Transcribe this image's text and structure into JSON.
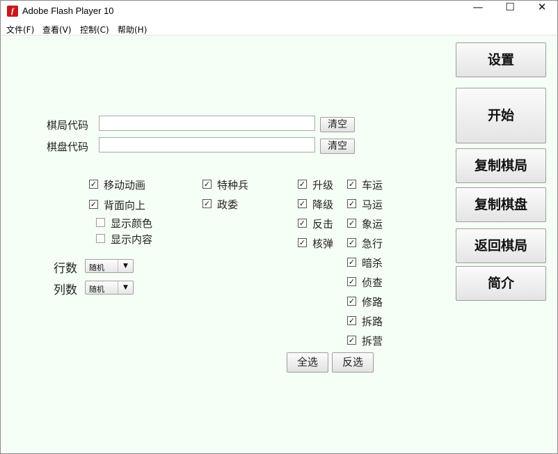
{
  "window": {
    "title": "Adobe Flash Player 10",
    "icon": "flash-player-icon",
    "icon_glyph": "f",
    "controls": {
      "minimize": "—",
      "maximize": "☐",
      "close": "✕"
    }
  },
  "menu": [
    "文件(F)",
    "查看(V)",
    "控制(C)",
    "帮助(H)"
  ],
  "side_buttons": [
    "设置",
    "开始",
    "复制棋局",
    "复制棋盘",
    "返回棋局",
    "简介"
  ],
  "codes": {
    "game_label": "棋局代码",
    "game_value": "",
    "board_label": "棋盘代码",
    "board_value": "",
    "clear_label": "清空"
  },
  "options": {
    "move_animation": {
      "label": "移动动画",
      "checked": true
    },
    "back_up": {
      "label": "背面向上",
      "checked": true
    },
    "show_color": {
      "label": "显示颜色",
      "checked": false
    },
    "show_content": {
      "label": "显示内容",
      "checked": false
    },
    "special_forces": {
      "label": "特种兵",
      "checked": true
    },
    "commissar": {
      "label": "政委",
      "checked": true
    }
  },
  "rules_left": [
    {
      "label": "升级",
      "checked": true
    },
    {
      "label": "降级",
      "checked": true
    },
    {
      "label": "反击",
      "checked": true
    },
    {
      "label": "核弹",
      "checked": true
    }
  ],
  "rules_right": [
    {
      "label": "车运",
      "checked": true
    },
    {
      "label": "马运",
      "checked": true
    },
    {
      "label": "象运",
      "checked": true
    },
    {
      "label": "急行",
      "checked": true
    },
    {
      "label": "暗杀",
      "checked": true
    },
    {
      "label": "侦查",
      "checked": true
    },
    {
      "label": "修路",
      "checked": true
    },
    {
      "label": "拆路",
      "checked": true
    },
    {
      "label": "拆营",
      "checked": true
    }
  ],
  "rows": {
    "label": "行数",
    "value": "随机"
  },
  "cols": {
    "label": "列数",
    "value": "随机"
  },
  "select_all_label": "全选",
  "invert_label": "反选",
  "check_mark": "✓"
}
